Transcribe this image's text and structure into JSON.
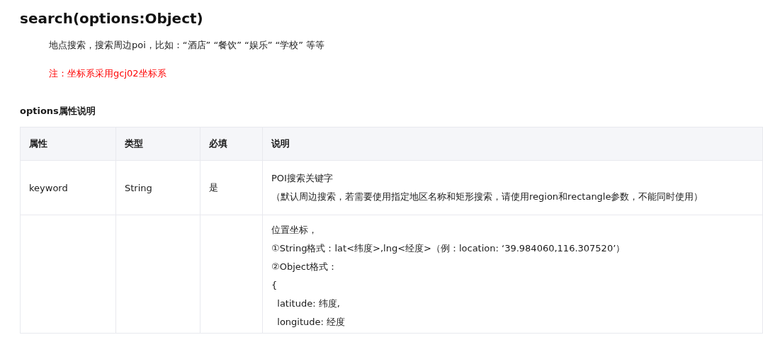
{
  "title": "search(options:Object)",
  "description": "地点搜索，搜索周边poi，比如：“酒店” “餐饮” “娱乐” “学校” 等等",
  "note": "注：坐标系采用gcj02坐标系",
  "options_heading": "options属性说明",
  "table": {
    "columns": [
      "属性",
      "类型",
      "必填",
      "说明"
    ],
    "rows": [
      {
        "cells": [
          "keyword",
          "String",
          "是"
        ],
        "description": [
          "POI搜索关键字",
          "（默认周边搜索，若需要使用指定地区名称和矩形搜索，请使用region和rectangle参数，不能同时使用）"
        ]
      },
      {
        "cells": [
          "",
          "",
          ""
        ],
        "description": [
          "位置坐标，",
          "①String格式：lat<纬度>,lng<经度>（例：location: ‘39.984060,116.307520’）",
          "②Object格式：",
          "{",
          "  latitude: 纬度,",
          "  longitude: 经度"
        ]
      }
    ]
  }
}
